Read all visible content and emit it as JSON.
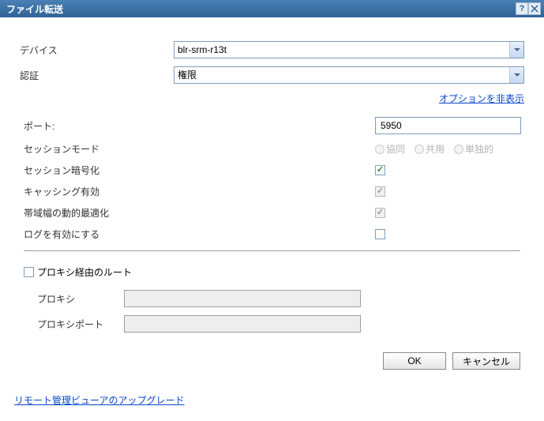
{
  "title": "ファイル転送",
  "device": {
    "label": "デバイス",
    "value": "blr-srm-r13t"
  },
  "auth": {
    "label": "認証",
    "value": "権限"
  },
  "options_link": "オプションを非表示",
  "port": {
    "label": "ポート:",
    "value": "5950"
  },
  "session_mode": {
    "label": "セッションモード",
    "options": {
      "collab": "協同",
      "shared": "共用",
      "exclusive": "単独的"
    }
  },
  "encryption": {
    "label": "セッション暗号化",
    "checked": true
  },
  "caching": {
    "label": "キャッシング有効",
    "checked": true
  },
  "bandwidth": {
    "label": "帯域幅の動的最適化",
    "checked": true
  },
  "logging": {
    "label": "ログを有効にする",
    "checked": false
  },
  "proxy_route": {
    "label": "プロキシ経由のルート",
    "checked": false
  },
  "proxy_host": {
    "label": "プロキシ",
    "value": ""
  },
  "proxy_port": {
    "label": "プロキシポート",
    "value": ""
  },
  "buttons": {
    "ok": "OK",
    "cancel": "キャンセル"
  },
  "upgrade_link": "リモート管理ビューアのアップグレード"
}
